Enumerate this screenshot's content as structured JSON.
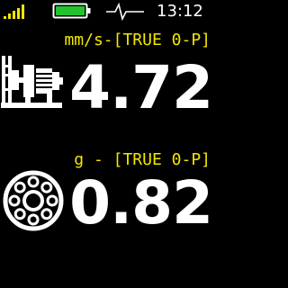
{
  "status": {
    "icons": [
      "signal-strength-icon",
      "battery-icon",
      "pulse-waveform-icon"
    ],
    "battery_level": 1.0,
    "signal_bars": 5,
    "time": "13:12",
    "colors": {
      "signal": "#f2e600",
      "battery": "#22c32e",
      "label": "#f2e600",
      "value": "#ffffff",
      "background": "#000000"
    }
  },
  "readings": [
    {
      "icon": "machine-train-icon",
      "label": "mm/s-[TRUE 0-P]",
      "value": "4.72"
    },
    {
      "icon": "bearing-icon",
      "label": "g - [TRUE 0-P]",
      "value": "0.82"
    }
  ]
}
